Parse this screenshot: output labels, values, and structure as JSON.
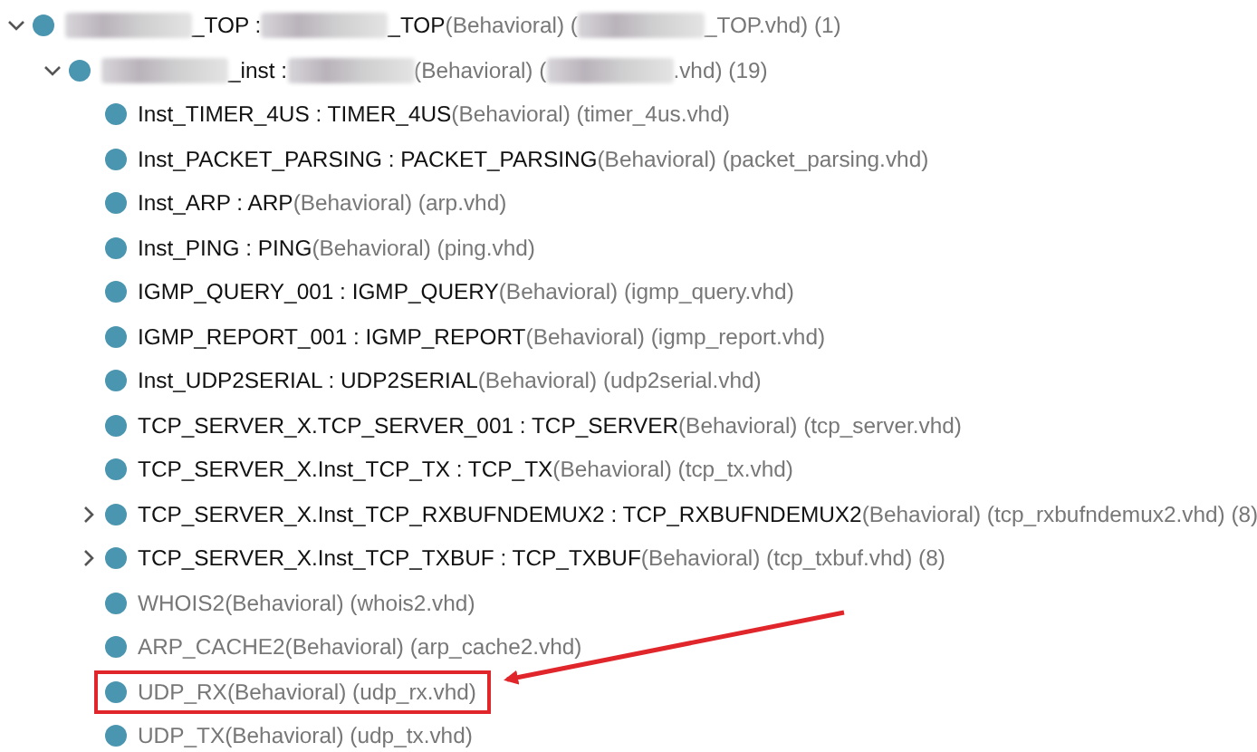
{
  "tree": [
    {
      "expanded": true,
      "highlighted": false,
      "parts": [
        {
          "kind": "redacted"
        },
        {
          "kind": "name",
          "text": "_TOP : "
        },
        {
          "kind": "redacted"
        },
        {
          "kind": "name",
          "text": "_TOP"
        },
        {
          "kind": "info",
          "text": "(Behavioral) ("
        },
        {
          "kind": "redacted"
        },
        {
          "kind": "info",
          "text": "_TOP.vhd) (1)"
        }
      ],
      "children": [
        {
          "expanded": true,
          "highlighted": false,
          "parts": [
            {
              "kind": "redacted"
            },
            {
              "kind": "name",
              "text": "_inst : "
            },
            {
              "kind": "redacted"
            },
            {
              "kind": "info",
              "text": "(Behavioral) ("
            },
            {
              "kind": "redacted"
            },
            {
              "kind": "info",
              "text": ".vhd) (19)"
            }
          ],
          "children": [
            {
              "highlighted": false,
              "parts": [
                {
                  "kind": "name",
                  "text": "Inst_TIMER_4US : TIMER_4US"
                },
                {
                  "kind": "info",
                  "text": "(Behavioral) (timer_4us.vhd)"
                }
              ]
            },
            {
              "highlighted": false,
              "parts": [
                {
                  "kind": "name",
                  "text": "Inst_PACKET_PARSING : PACKET_PARSING"
                },
                {
                  "kind": "info",
                  "text": "(Behavioral) (packet_parsing.vhd)"
                }
              ]
            },
            {
              "highlighted": false,
              "parts": [
                {
                  "kind": "name",
                  "text": "Inst_ARP : ARP"
                },
                {
                  "kind": "info",
                  "text": "(Behavioral) (arp.vhd)"
                }
              ]
            },
            {
              "highlighted": false,
              "parts": [
                {
                  "kind": "name",
                  "text": "Inst_PING : PING"
                },
                {
                  "kind": "info",
                  "text": "(Behavioral) (ping.vhd)"
                }
              ]
            },
            {
              "highlighted": false,
              "parts": [
                {
                  "kind": "name",
                  "text": "IGMP_QUERY_001 : IGMP_QUERY"
                },
                {
                  "kind": "info",
                  "text": "(Behavioral) (igmp_query.vhd)"
                }
              ]
            },
            {
              "highlighted": false,
              "parts": [
                {
                  "kind": "name",
                  "text": "IGMP_REPORT_001 : IGMP_REPORT"
                },
                {
                  "kind": "info",
                  "text": "(Behavioral) (igmp_report.vhd)"
                }
              ]
            },
            {
              "highlighted": false,
              "parts": [
                {
                  "kind": "name",
                  "text": "Inst_UDP2SERIAL : UDP2SERIAL"
                },
                {
                  "kind": "info",
                  "text": "(Behavioral) (udp2serial.vhd)"
                }
              ]
            },
            {
              "highlighted": false,
              "parts": [
                {
                  "kind": "name",
                  "text": "TCP_SERVER_X.TCP_SERVER_001 : TCP_SERVER"
                },
                {
                  "kind": "info",
                  "text": "(Behavioral) (tcp_server.vhd)"
                }
              ]
            },
            {
              "highlighted": false,
              "parts": [
                {
                  "kind": "name",
                  "text": "TCP_SERVER_X.Inst_TCP_TX : TCP_TX"
                },
                {
                  "kind": "info",
                  "text": "(Behavioral) (tcp_tx.vhd)"
                }
              ]
            },
            {
              "expanded": false,
              "highlighted": false,
              "parts": [
                {
                  "kind": "name",
                  "text": "TCP_SERVER_X.Inst_TCP_RXBUFNDEMUX2 : TCP_RXBUFNDEMUX2"
                },
                {
                  "kind": "info",
                  "text": "(Behavioral) (tcp_rxbufndemux2.vhd) (8)"
                }
              ]
            },
            {
              "expanded": false,
              "highlighted": false,
              "parts": [
                {
                  "kind": "name",
                  "text": "TCP_SERVER_X.Inst_TCP_TXBUF : TCP_TXBUF"
                },
                {
                  "kind": "info",
                  "text": "(Behavioral) (tcp_txbuf.vhd) (8)"
                }
              ]
            },
            {
              "highlighted": false,
              "parts": [
                {
                  "kind": "info",
                  "text": "WHOIS2(Behavioral) (whois2.vhd)"
                }
              ]
            },
            {
              "highlighted": false,
              "parts": [
                {
                  "kind": "info",
                  "text": "ARP_CACHE2(Behavioral) (arp_cache2.vhd)"
                }
              ]
            },
            {
              "highlighted": true,
              "parts": [
                {
                  "kind": "info",
                  "text": "UDP_RX(Behavioral) (udp_rx.vhd)"
                }
              ]
            },
            {
              "highlighted": false,
              "parts": [
                {
                  "kind": "info",
                  "text": "UDP_TX(Behavioral) (udp_tx.vhd)"
                }
              ]
            }
          ]
        }
      ]
    }
  ]
}
